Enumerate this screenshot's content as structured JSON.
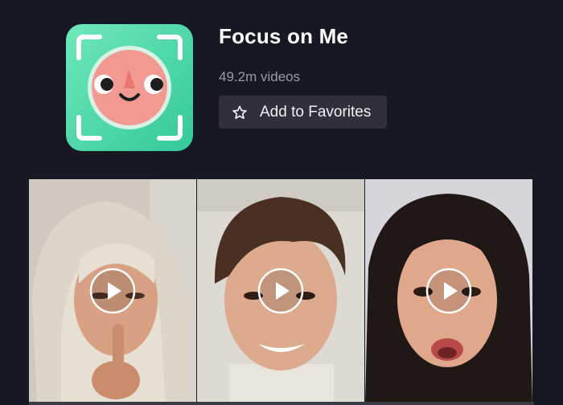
{
  "effect": {
    "icon": "focus-face-icon",
    "title": "Focus on Me",
    "video_count": "49.2m videos",
    "favorite_label": "Add to Favorites",
    "favorite_icon": "star-outline-icon"
  },
  "colors": {
    "background": "#161823",
    "button_bg": "#2f3039",
    "icon_gradient_start": "#3fd6a6",
    "icon_gradient_end": "#8ff0c8",
    "face": "#f28f8f"
  },
  "videos": [
    {
      "icon": "play-icon"
    },
    {
      "icon": "play-icon"
    },
    {
      "icon": "play-icon"
    }
  ]
}
